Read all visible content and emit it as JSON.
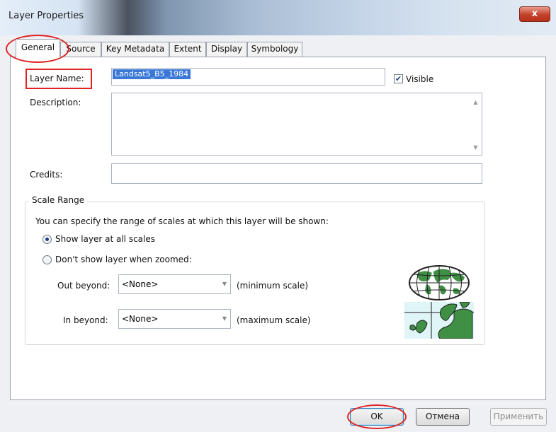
{
  "window": {
    "title": "Layer Properties",
    "close_glyph": "x"
  },
  "tabs": [
    "General",
    "Source",
    "Key Metadata",
    "Extent",
    "Display",
    "Symbology"
  ],
  "general": {
    "layer_name_label": "Layer Name:",
    "layer_name_value": "Landsat5_B5_1984",
    "visible_label": "Visible",
    "visible_checked": true,
    "description_label": "Description:",
    "description_value": "",
    "credits_label": "Credits:",
    "credits_value": ""
  },
  "scale_range": {
    "title": "Scale Range",
    "info": "You can specify the range of scales at which this layer will be shown:",
    "option_all": "Show layer at all scales",
    "option_zoomed": "Don't show layer when zoomed:",
    "selected_option": "all",
    "out_beyond_label": "Out beyond:",
    "out_beyond_value": "<None>",
    "out_beyond_hint": "(minimum scale)",
    "in_beyond_label": "In beyond:",
    "in_beyond_value": "<None>",
    "in_beyond_hint": "(maximum scale)"
  },
  "buttons": {
    "ok": "OK",
    "cancel": "Отмена",
    "apply": "Применить"
  },
  "colors": {
    "highlight": "#e02424",
    "selection": "#3a78d8",
    "map_green": "#3f8f45"
  },
  "icons": [
    "close-icon",
    "check-icon",
    "scroll-up-icon",
    "scroll-down-icon",
    "dropdown-arrow-icon",
    "globe-map-icon",
    "europe-map-icon"
  ]
}
